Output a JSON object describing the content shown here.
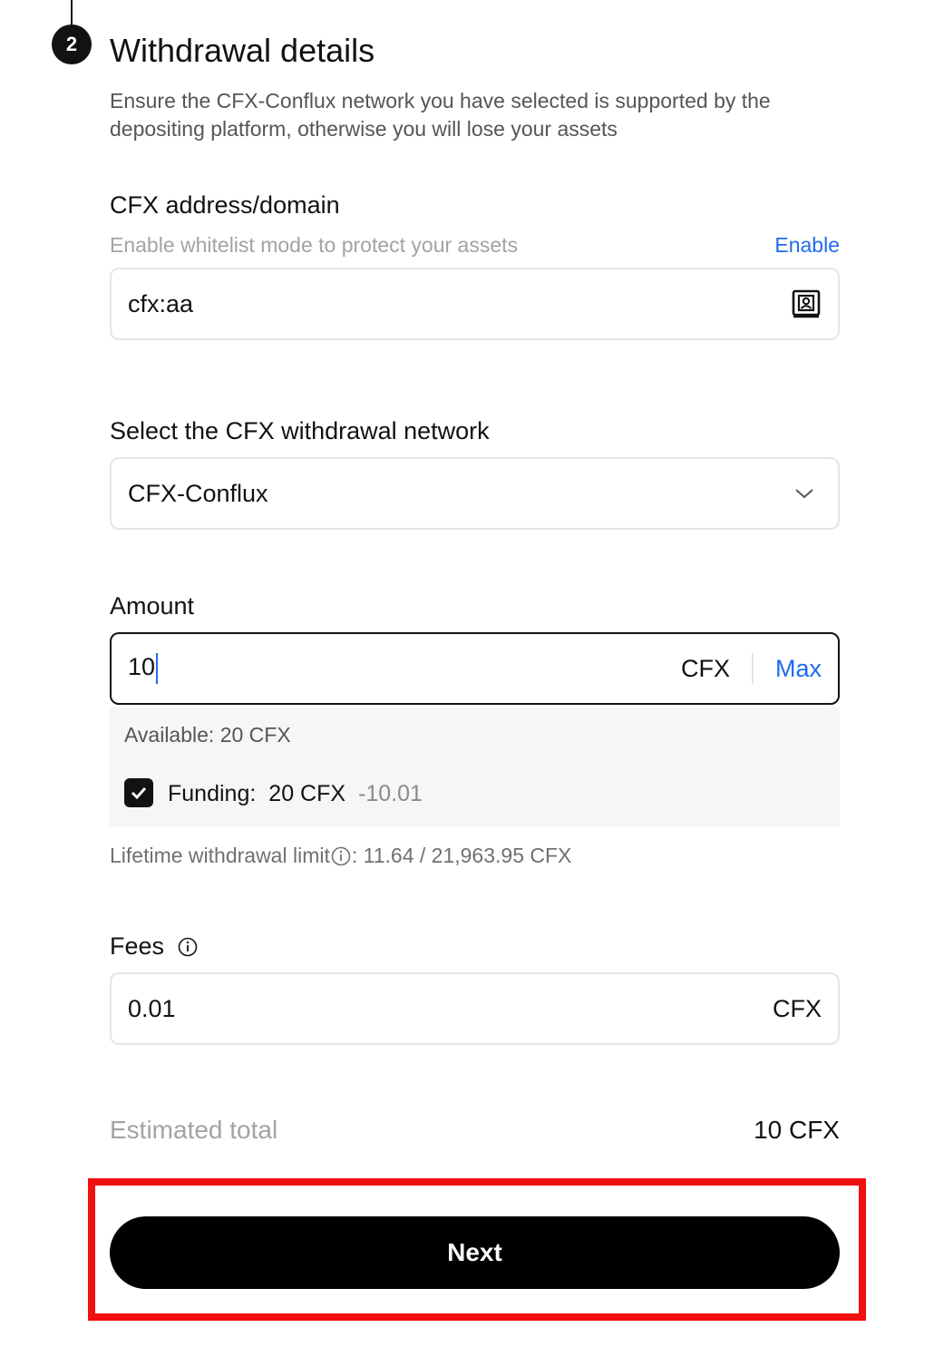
{
  "step": {
    "number": "2",
    "title": "Withdrawal details"
  },
  "description": "Ensure the CFX-Conflux network you have selected is supported by the depositing platform, otherwise you will lose your assets",
  "address": {
    "label": "CFX address/domain",
    "hint": "Enable whitelist mode to protect your assets",
    "enable_link": "Enable",
    "value": "cfx:aa",
    "icon": "address-book-icon"
  },
  "network": {
    "label": "Select the CFX withdrawal network",
    "selected": "CFX-Conflux",
    "icon": "chevron-down-icon"
  },
  "amount": {
    "label": "Amount",
    "value": "10",
    "unit": "CFX",
    "max_label": "Max",
    "available": "Available: 20 CFX",
    "funding_label": "Funding:",
    "funding_value": "20 CFX",
    "funding_delta": "-10.01",
    "funding_checked": true
  },
  "limit": {
    "label": "Lifetime withdrawal limit",
    "value": ": 11.64 / 21,963.95 CFX"
  },
  "fees": {
    "label": "Fees",
    "value": "0.01",
    "unit": "CFX"
  },
  "estimated": {
    "label": "Estimated total",
    "value": "10 CFX"
  },
  "next_label": "Next",
  "colors": {
    "accent": "#1f6bf2",
    "highlight": "#f01010",
    "button": "#000000"
  }
}
